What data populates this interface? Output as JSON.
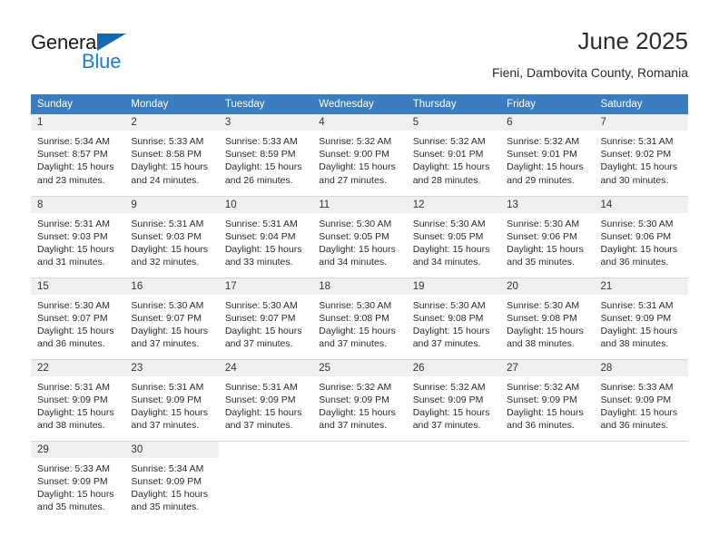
{
  "brand": {
    "name_part1": "General",
    "name_part2": "Blue",
    "triangle_color": "#1668b3",
    "blue_color": "#1a7fd4"
  },
  "header": {
    "month_title": "June 2025",
    "location": "Fieni, Dambovita County, Romania"
  },
  "calendar": {
    "header_bg": "#3a7cc0",
    "date_band_bg": "#efefef",
    "weekday_headers": [
      "Sunday",
      "Monday",
      "Tuesday",
      "Wednesday",
      "Thursday",
      "Friday",
      "Saturday"
    ],
    "weeks": [
      [
        {
          "date": "1",
          "sunrise": "Sunrise: 5:34 AM",
          "sunset": "Sunset: 8:57 PM",
          "daylight": "Daylight: 15 hours and 23 minutes."
        },
        {
          "date": "2",
          "sunrise": "Sunrise: 5:33 AM",
          "sunset": "Sunset: 8:58 PM",
          "daylight": "Daylight: 15 hours and 24 minutes."
        },
        {
          "date": "3",
          "sunrise": "Sunrise: 5:33 AM",
          "sunset": "Sunset: 8:59 PM",
          "daylight": "Daylight: 15 hours and 26 minutes."
        },
        {
          "date": "4",
          "sunrise": "Sunrise: 5:32 AM",
          "sunset": "Sunset: 9:00 PM",
          "daylight": "Daylight: 15 hours and 27 minutes."
        },
        {
          "date": "5",
          "sunrise": "Sunrise: 5:32 AM",
          "sunset": "Sunset: 9:01 PM",
          "daylight": "Daylight: 15 hours and 28 minutes."
        },
        {
          "date": "6",
          "sunrise": "Sunrise: 5:32 AM",
          "sunset": "Sunset: 9:01 PM",
          "daylight": "Daylight: 15 hours and 29 minutes."
        },
        {
          "date": "7",
          "sunrise": "Sunrise: 5:31 AM",
          "sunset": "Sunset: 9:02 PM",
          "daylight": "Daylight: 15 hours and 30 minutes."
        }
      ],
      [
        {
          "date": "8",
          "sunrise": "Sunrise: 5:31 AM",
          "sunset": "Sunset: 9:03 PM",
          "daylight": "Daylight: 15 hours and 31 minutes."
        },
        {
          "date": "9",
          "sunrise": "Sunrise: 5:31 AM",
          "sunset": "Sunset: 9:03 PM",
          "daylight": "Daylight: 15 hours and 32 minutes."
        },
        {
          "date": "10",
          "sunrise": "Sunrise: 5:31 AM",
          "sunset": "Sunset: 9:04 PM",
          "daylight": "Daylight: 15 hours and 33 minutes."
        },
        {
          "date": "11",
          "sunrise": "Sunrise: 5:30 AM",
          "sunset": "Sunset: 9:05 PM",
          "daylight": "Daylight: 15 hours and 34 minutes."
        },
        {
          "date": "12",
          "sunrise": "Sunrise: 5:30 AM",
          "sunset": "Sunset: 9:05 PM",
          "daylight": "Daylight: 15 hours and 34 minutes."
        },
        {
          "date": "13",
          "sunrise": "Sunrise: 5:30 AM",
          "sunset": "Sunset: 9:06 PM",
          "daylight": "Daylight: 15 hours and 35 minutes."
        },
        {
          "date": "14",
          "sunrise": "Sunrise: 5:30 AM",
          "sunset": "Sunset: 9:06 PM",
          "daylight": "Daylight: 15 hours and 36 minutes."
        }
      ],
      [
        {
          "date": "15",
          "sunrise": "Sunrise: 5:30 AM",
          "sunset": "Sunset: 9:07 PM",
          "daylight": "Daylight: 15 hours and 36 minutes."
        },
        {
          "date": "16",
          "sunrise": "Sunrise: 5:30 AM",
          "sunset": "Sunset: 9:07 PM",
          "daylight": "Daylight: 15 hours and 37 minutes."
        },
        {
          "date": "17",
          "sunrise": "Sunrise: 5:30 AM",
          "sunset": "Sunset: 9:07 PM",
          "daylight": "Daylight: 15 hours and 37 minutes."
        },
        {
          "date": "18",
          "sunrise": "Sunrise: 5:30 AM",
          "sunset": "Sunset: 9:08 PM",
          "daylight": "Daylight: 15 hours and 37 minutes."
        },
        {
          "date": "19",
          "sunrise": "Sunrise: 5:30 AM",
          "sunset": "Sunset: 9:08 PM",
          "daylight": "Daylight: 15 hours and 37 minutes."
        },
        {
          "date": "20",
          "sunrise": "Sunrise: 5:30 AM",
          "sunset": "Sunset: 9:08 PM",
          "daylight": "Daylight: 15 hours and 38 minutes."
        },
        {
          "date": "21",
          "sunrise": "Sunrise: 5:31 AM",
          "sunset": "Sunset: 9:09 PM",
          "daylight": "Daylight: 15 hours and 38 minutes."
        }
      ],
      [
        {
          "date": "22",
          "sunrise": "Sunrise: 5:31 AM",
          "sunset": "Sunset: 9:09 PM",
          "daylight": "Daylight: 15 hours and 38 minutes."
        },
        {
          "date": "23",
          "sunrise": "Sunrise: 5:31 AM",
          "sunset": "Sunset: 9:09 PM",
          "daylight": "Daylight: 15 hours and 37 minutes."
        },
        {
          "date": "24",
          "sunrise": "Sunrise: 5:31 AM",
          "sunset": "Sunset: 9:09 PM",
          "daylight": "Daylight: 15 hours and 37 minutes."
        },
        {
          "date": "25",
          "sunrise": "Sunrise: 5:32 AM",
          "sunset": "Sunset: 9:09 PM",
          "daylight": "Daylight: 15 hours and 37 minutes."
        },
        {
          "date": "26",
          "sunrise": "Sunrise: 5:32 AM",
          "sunset": "Sunset: 9:09 PM",
          "daylight": "Daylight: 15 hours and 37 minutes."
        },
        {
          "date": "27",
          "sunrise": "Sunrise: 5:32 AM",
          "sunset": "Sunset: 9:09 PM",
          "daylight": "Daylight: 15 hours and 36 minutes."
        },
        {
          "date": "28",
          "sunrise": "Sunrise: 5:33 AM",
          "sunset": "Sunset: 9:09 PM",
          "daylight": "Daylight: 15 hours and 36 minutes."
        }
      ],
      [
        {
          "date": "29",
          "sunrise": "Sunrise: 5:33 AM",
          "sunset": "Sunset: 9:09 PM",
          "daylight": "Daylight: 15 hours and 35 minutes."
        },
        {
          "date": "30",
          "sunrise": "Sunrise: 5:34 AM",
          "sunset": "Sunset: 9:09 PM",
          "daylight": "Daylight: 15 hours and 35 minutes."
        },
        null,
        null,
        null,
        null,
        null
      ]
    ]
  }
}
